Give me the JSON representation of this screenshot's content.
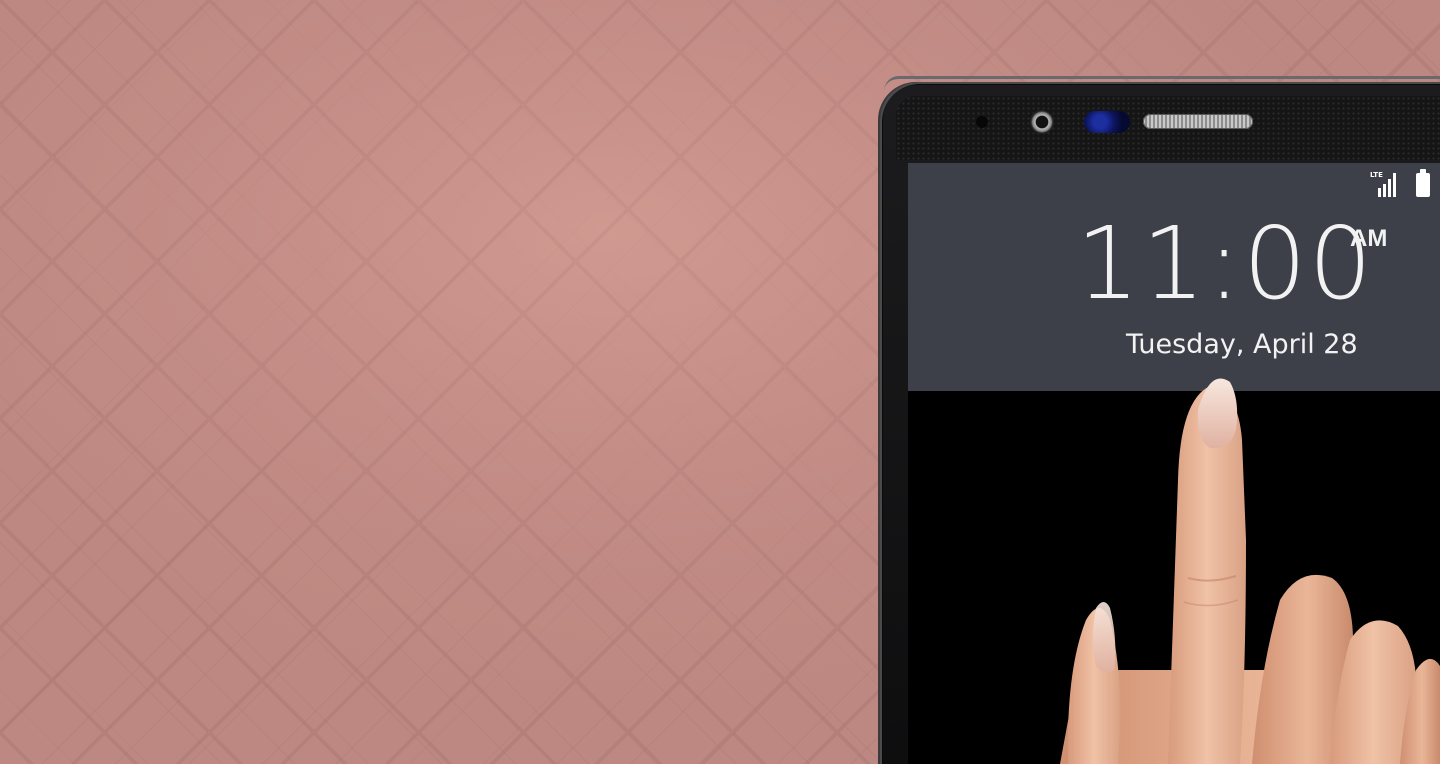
{
  "scene": {
    "background_color": "#c08c86",
    "screen_panel_color": "#3d4049"
  },
  "phone": {
    "status_bar": {
      "network_label": "LTE",
      "network_icon": "signal-bars-icon",
      "battery_icon": "battery-full-icon"
    },
    "lock_screen": {
      "time": "11:00",
      "ampm": "AM",
      "date": "Tuesday, April 28"
    }
  }
}
